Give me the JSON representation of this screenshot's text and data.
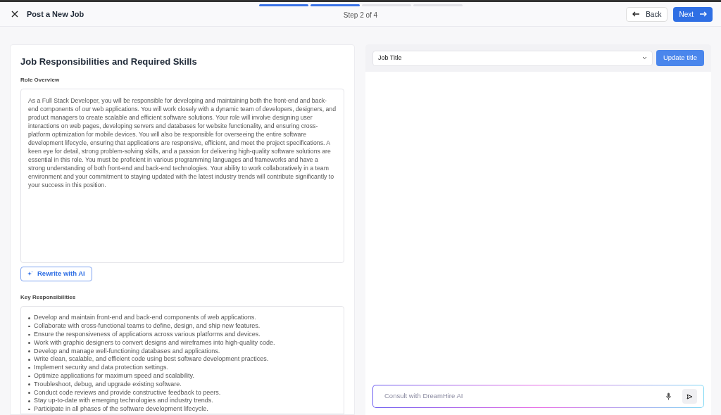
{
  "header": {
    "title": "Post a New Job",
    "steps": [
      {
        "done": true
      },
      {
        "done": true
      },
      {
        "done": false
      },
      {
        "done": false
      }
    ],
    "step_label": "Step 2 of 4",
    "back": "Back",
    "next": "Next"
  },
  "form": {
    "title": "Job Responsibilities and Required Skills",
    "role_overview": {
      "label": "Role Overview",
      "value": "As a Full Stack Developer, you will be responsible for developing and maintaining both the front-end and back-end components of our web applications. You will work closely with a dynamic team of developers, designers, and product managers to create scalable and efficient software solutions. Your role will involve designing user interactions on web pages, developing servers and databases for website functionality, and ensuring cross-platform optimization for mobile devices. You will also be responsible for overseeing the entire software development lifecycle, ensuring that applications are responsive, efficient, and meet the project specifications. A keen eye for detail, strong problem-solving skills, and a passion for delivering high-quality software solutions are essential in this role. You must be proficient in various programming languages and frameworks and have a strong understanding of both front-end and back-end technologies. Your ability to work collaboratively in a team environment and your commitment to staying updated with the latest industry trends will contribute significantly to your success in this position."
    },
    "rewrite_button": "Rewrite with AI",
    "key_responsibilities": {
      "label": "Key Responsibilities",
      "items": [
        "Develop and maintain front-end and back-end components of web applications.",
        "Collaborate with cross-functional teams to define, design, and ship new features.",
        "Ensure the responsiveness of applications across various platforms and devices.",
        "Work with graphic designers to convert designs and wireframes into high-quality code.",
        "Develop and manage well-functioning databases and applications.",
        "Write clean, scalable, and efficient code using best software development practices.",
        "Implement security and data protection settings.",
        "Optimize applications for maximum speed and scalability.",
        "Troubleshoot, debug, and upgrade existing software.",
        "Conduct code reviews and provide constructive feedback to peers.",
        "Stay up-to-date with emerging technologies and industry trends.",
        "Participate in all phases of the software development lifecycle."
      ]
    }
  },
  "assistant": {
    "select_value": "Job Title",
    "update_button": "Update title",
    "chat_placeholder": "Consult with DreamHire AI"
  }
}
